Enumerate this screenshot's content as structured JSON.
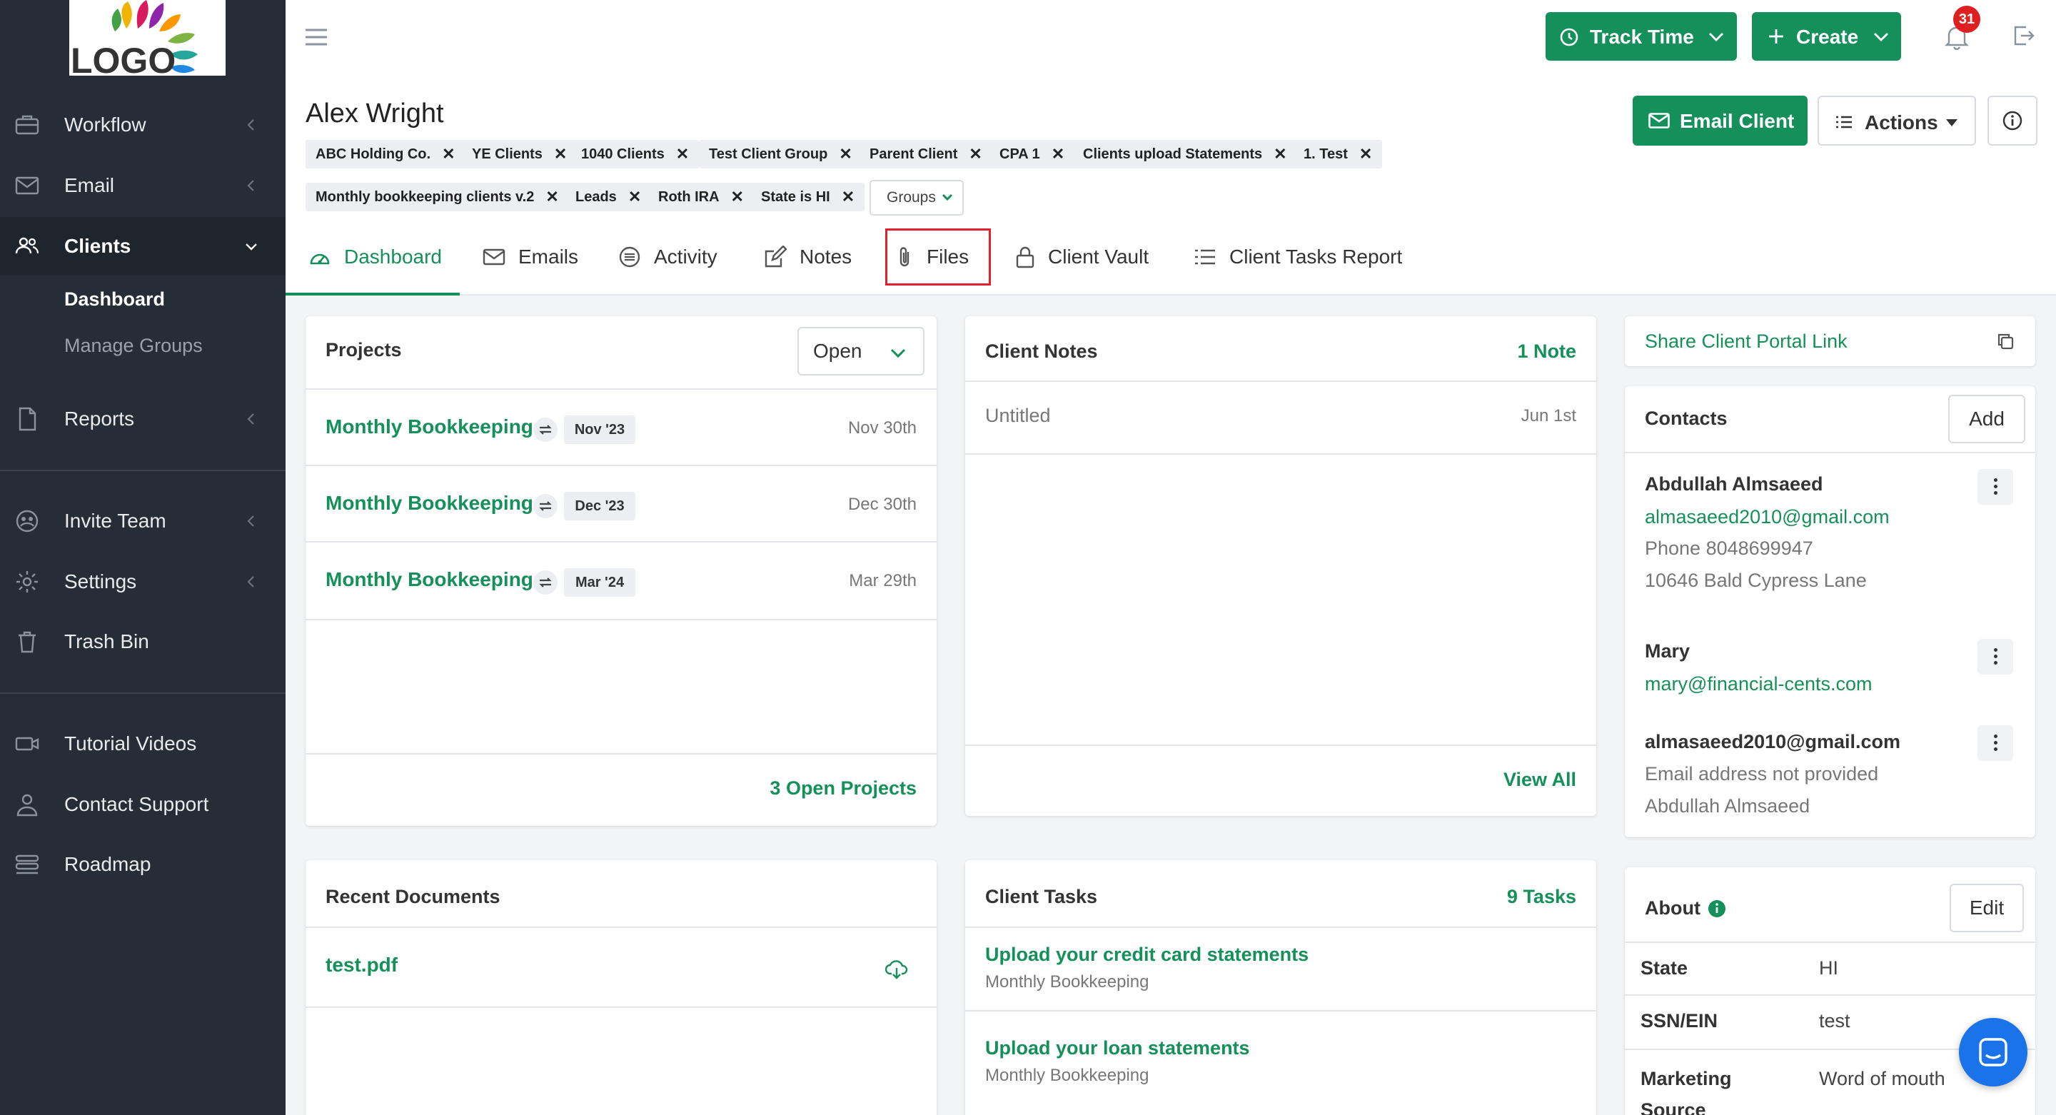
{
  "brand": {
    "logo_text": "LOGO",
    "accent": "#16905a",
    "sidebar_bg": "#262d36"
  },
  "sidebar": {
    "items": [
      {
        "label": "Workflow",
        "icon": "briefcase-icon"
      },
      {
        "label": "Email",
        "icon": "envelope-icon"
      },
      {
        "label": "Clients",
        "icon": "users-icon"
      },
      {
        "label": "Reports",
        "icon": "document-icon"
      },
      {
        "label": "Invite Team",
        "icon": "team-icon"
      },
      {
        "label": "Settings",
        "icon": "gear-icon"
      },
      {
        "label": "Trash Bin",
        "icon": "trash-icon"
      },
      {
        "label": "Tutorial Videos",
        "icon": "video-icon"
      },
      {
        "label": "Contact Support",
        "icon": "person-icon"
      },
      {
        "label": "Roadmap",
        "icon": "roadmap-icon"
      }
    ],
    "clients_sub": [
      "Dashboard",
      "Manage Groups"
    ]
  },
  "topbar": {
    "track_time": "Track Time",
    "create": "Create",
    "notification_count": "31"
  },
  "client": {
    "name": "Alex Wright",
    "tags": [
      "ABC Holding Co.",
      "YE Clients",
      "1040 Clients",
      "Test Client Group",
      "Parent Client",
      "CPA 1",
      "Clients upload Statements",
      "1. Test",
      "Monthly bookkeeping clients v.2",
      "Leads",
      "Roth IRA",
      "State is HI"
    ],
    "groups_label": "Groups",
    "email_client": "Email Client",
    "actions": "Actions"
  },
  "tabs": [
    "Dashboard",
    "Emails",
    "Activity",
    "Notes",
    "Files",
    "Client Vault",
    "Client Tasks Report"
  ],
  "projects": {
    "title": "Projects",
    "filter": "Open",
    "rows": [
      {
        "name": "Monthly Bookkeeping",
        "period": "Nov '23",
        "due": "Nov 30th"
      },
      {
        "name": "Monthly Bookkeeping",
        "period": "Dec '23",
        "due": "Dec 30th"
      },
      {
        "name": "Monthly Bookkeeping",
        "period": "Mar '24",
        "due": "Mar 29th"
      }
    ],
    "footer": "3 Open Projects"
  },
  "notes": {
    "title": "Client Notes",
    "count": "1 Note",
    "rows": [
      {
        "title": "Untitled",
        "date": "Jun 1st"
      }
    ],
    "footer": "View All"
  },
  "documents": {
    "title": "Recent Documents",
    "rows": [
      {
        "name": "test.pdf"
      }
    ]
  },
  "tasks": {
    "title": "Client Tasks",
    "count": "9 Tasks",
    "rows": [
      {
        "title": "Upload your credit card statements",
        "project": "Monthly Bookkeeping"
      },
      {
        "title": "Upload your loan statements",
        "project": "Monthly Bookkeeping"
      }
    ]
  },
  "portal": {
    "label": "Share Client Portal Link"
  },
  "contacts": {
    "title": "Contacts",
    "add": "Add",
    "list": [
      {
        "name": "Abdullah Almsaeed",
        "email": "almasaeed2010@gmail.com",
        "phone": "Phone 8048699947",
        "address": "10646 Bald Cypress Lane"
      },
      {
        "name": "Mary",
        "email": "mary@financial-cents.com"
      },
      {
        "name": "almasaeed2010@gmail.com",
        "line1": "Email address not provided",
        "line2": "Abdullah Almsaeed"
      }
    ]
  },
  "about": {
    "title": "About",
    "edit": "Edit",
    "rows": [
      {
        "label": "State",
        "value": "HI"
      },
      {
        "label": "SSN/EIN",
        "value": "test"
      },
      {
        "label": "Marketing Source",
        "value": "Word of mouth"
      }
    ]
  }
}
